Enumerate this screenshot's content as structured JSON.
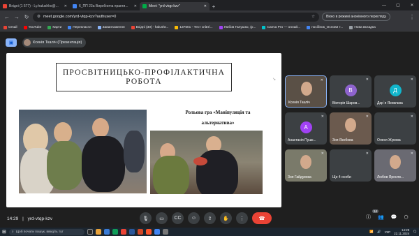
{
  "browser": {
    "tabs": [
      {
        "label": "Вхідні (1 577) - Ly.halushko@...",
        "color": "#ea4335",
        "active": false
      },
      {
        "label": "6_ПП 23а Виробнича практи...",
        "color": "#4285f4",
        "active": false
      },
      {
        "label": "Meet: \"yrd-vtqp-kzv\"",
        "color": "#00ac47",
        "active": true
      }
    ],
    "new_tab": "+",
    "url": "meet.google.com/yrd-vtqp-kzv?authuser=0",
    "incognito_label": "Вікно в режимі анонімного перегляду",
    "bookmarks": [
      {
        "label": "Gmail",
        "color": "#ea4335"
      },
      {
        "label": "YouTube",
        "color": "#ff0000"
      },
      {
        "label": "Карти",
        "color": "#34a853"
      },
      {
        "label": "Перекласти",
        "color": "#4285f4"
      },
      {
        "label": "Завантаження",
        "color": "#8ab4f8"
      },
      {
        "label": "Вхідні (30) - halusht...",
        "color": "#ea4335"
      },
      {
        "label": "137501 - Тест співті...",
        "color": "#fbbc04"
      },
      {
        "label": "Любов Галушко, (р...",
        "color": "#a142f4"
      },
      {
        "label": "Canva Pro — онлай...",
        "color": "#00c4cc"
      },
      {
        "label": "посібник_Основи т...",
        "color": "#4285f4"
      },
      {
        "label": "Нова вкладка",
        "color": "#9aa0a6"
      }
    ]
  },
  "meet": {
    "presenter_label": "Ксенія Ткаліч (Презентація)",
    "slide": {
      "title": "ПРОСВІТНИЦЬКО-ПРОФІЛАКТИЧНА РОБОТА",
      "caption_line1": "Рольова гра «Маніпуляція та",
      "caption_line2": "альтернатива»"
    },
    "participants": [
      {
        "name": "Ксенія Ткаліч",
        "initial": "",
        "color": "#5a5046",
        "video": true
      },
      {
        "name": "Вікторія Шаров...",
        "initial": "В",
        "color": "#8e63ce",
        "video": false
      },
      {
        "name": "Дар`я Яковлєва",
        "initial": "Д",
        "color": "#12b5cb",
        "video": false
      },
      {
        "name": "Анастасія Пушк...",
        "initial": "А",
        "color": "#a142f4",
        "video": false
      },
      {
        "name": "Зоя Якобова",
        "initial": "",
        "color": "#6b5a4e",
        "video": true
      },
      {
        "name": "Олеся Жукова",
        "initial": "",
        "color": "#3c4043",
        "video": false
      },
      {
        "name": "Зоя Гайдукова",
        "initial": "",
        "color": "#7a7a6a",
        "video": true
      },
      {
        "name": "Ще 4 особи",
        "initial": "",
        "color": "#3c4043",
        "video": false
      },
      {
        "name": "Любов Ярослв...",
        "initial": "",
        "color": "#6a6a72",
        "video": true
      }
    ],
    "time": "14:29",
    "separator": "|",
    "meeting_code": "yrd-vtqp-kzv",
    "participant_count": "14"
  },
  "taskbar": {
    "search_placeholder": "Щоб почати пошук, введіть тут",
    "language": "УКР",
    "time": "14:29",
    "date": "22.11.2024"
  }
}
